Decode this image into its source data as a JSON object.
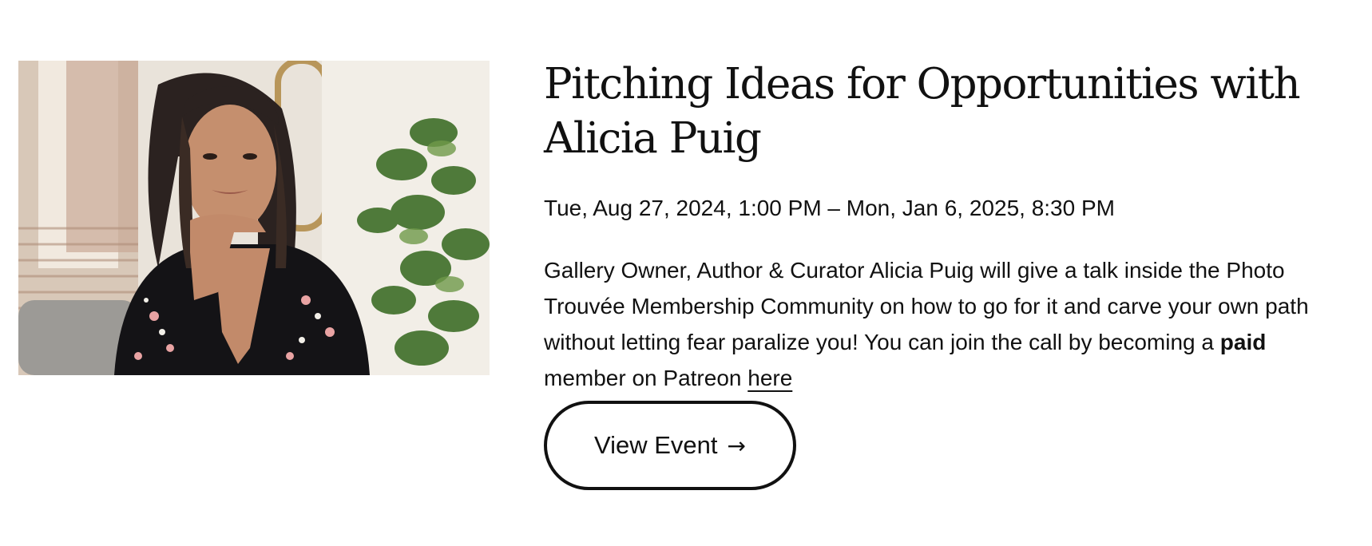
{
  "event": {
    "title": "Pitching Ideas for Opportunities with Alicia Puig",
    "date": "Tue, Aug 27, 2024, 1:00 PM – Mon, Jan 6, 2025, 8:30 PM",
    "description_part1": "Gallery Owner, Author & Curator Alicia Puig will give a talk inside the Photo Trouvée Membership Community on how to go for it and carve your own path without letting fear paralize you! You can join the call by becoming a ",
    "description_bold": "paid",
    "description_part2": " member on Patreon ",
    "link_text": "here",
    "button_label": "View Event",
    "button_icon": "→"
  }
}
